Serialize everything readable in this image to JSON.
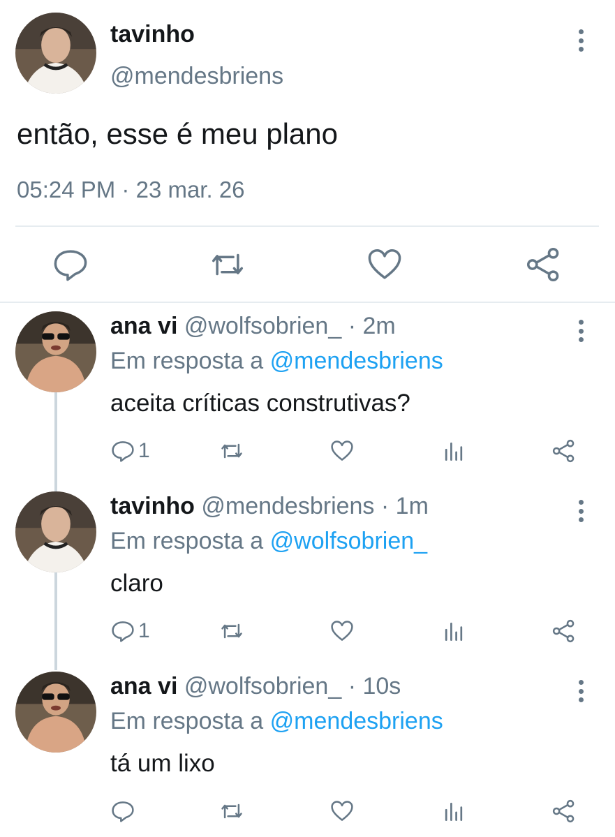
{
  "main_tweet": {
    "name": "tavinho",
    "handle": "@mendesbriens",
    "text": "então, esse é meu plano",
    "time": "05:24 PM",
    "separator": "·",
    "date": "23 mar. 26",
    "actions": [
      "reply-icon",
      "retweet-icon",
      "like-icon",
      "share-icon"
    ]
  },
  "replies": [
    {
      "name": "ana vi",
      "handle": "@wolfsobrien_",
      "separator": "·",
      "time": "2m",
      "in_reply_prefix": "Em resposta a",
      "in_reply_mention": "@mendesbriens",
      "text": "aceita críticas construtivas?",
      "reply_count": "1"
    },
    {
      "name": "tavinho",
      "handle": "@mendesbriens",
      "separator": "·",
      "time": "1m",
      "in_reply_prefix": "Em resposta a",
      "in_reply_mention": "@wolfsobrien_",
      "text": "claro",
      "reply_count": "1"
    },
    {
      "name": "ana vi",
      "handle": "@wolfsobrien_",
      "separator": "·",
      "time": "10s",
      "in_reply_prefix": "Em resposta a",
      "in_reply_mention": "@mendesbriens",
      "text": "tá um lixo",
      "reply_count": ""
    }
  ],
  "colors": {
    "text": "#14171a",
    "secondary": "#657786",
    "link": "#1da1f2",
    "divider": "#e6ecf0",
    "thread_line": "#ccd6dd"
  }
}
